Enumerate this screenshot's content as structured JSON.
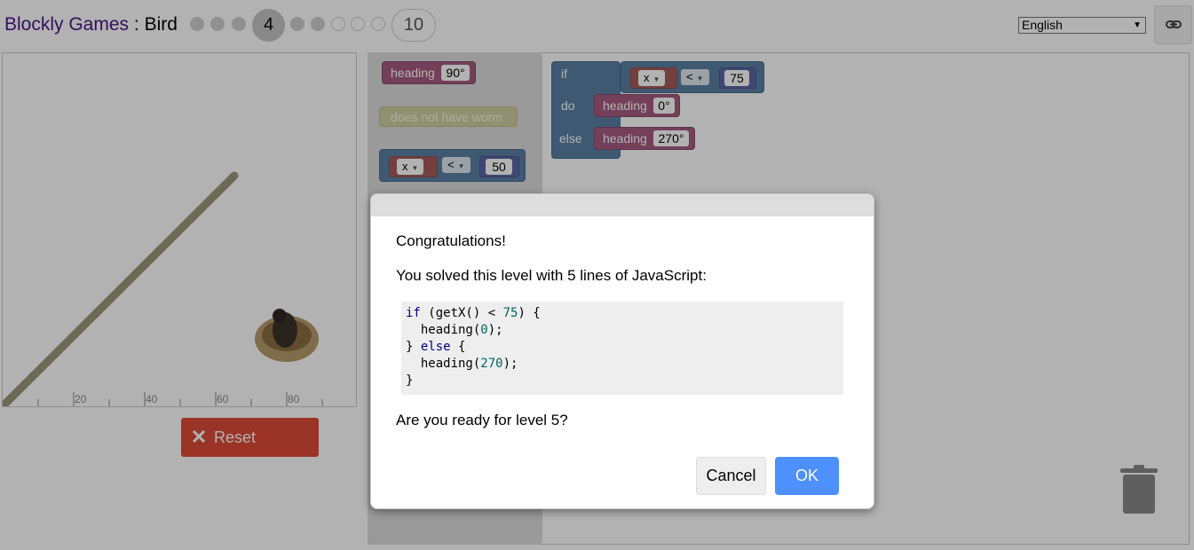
{
  "header": {
    "app_name": "Blockly Games",
    "separator": " : ",
    "game_name": "Bird",
    "current_level": "4",
    "last_level": "10",
    "language": "English",
    "link_icon": "link-icon"
  },
  "visualization": {
    "ruler_labels": [
      "20",
      "40",
      "60",
      "80"
    ],
    "reset_label": "Reset",
    "reset_icon": "close-icon",
    "bird_icon": "bird-icon"
  },
  "toolbox": {
    "heading_label": "heading",
    "heading_value": "90°",
    "worm_label": "does not have worm",
    "compare_var": "x",
    "compare_op": "<",
    "compare_value": "50"
  },
  "workspace": {
    "if_label": "if",
    "do_label": "do",
    "else_label": "else",
    "compare_var": "x",
    "compare_op": "<",
    "compare_value": "75",
    "do_heading_label": "heading",
    "do_heading_value": "0°",
    "else_heading_label": "heading",
    "else_heading_value": "270°",
    "trash_icon": "trash-icon"
  },
  "dialog": {
    "title": "Congratulations!",
    "message": "You solved this level with 5 lines of JavaScript:",
    "code": {
      "line1": {
        "kw": "if",
        "p1": " (getX() < ",
        "num": "75",
        "p2": ") {"
      },
      "line2": {
        "pre": "  heading(",
        "num": "0",
        "post": ");"
      },
      "line3": {
        "p1": "} ",
        "kw": "else",
        "p2": " {"
      },
      "line4": {
        "pre": "  heading(",
        "num": "270",
        "post": ");"
      },
      "line5": "}"
    },
    "question": "Are you ready for level 5?",
    "cancel_label": "Cancel",
    "ok_label": "OK"
  },
  "colors": {
    "reset": "#dd4b39",
    "ok": "#4d90fe",
    "title": "#4a148c",
    "heading_block": "#a55b80",
    "logic_block": "#5b80a5"
  }
}
